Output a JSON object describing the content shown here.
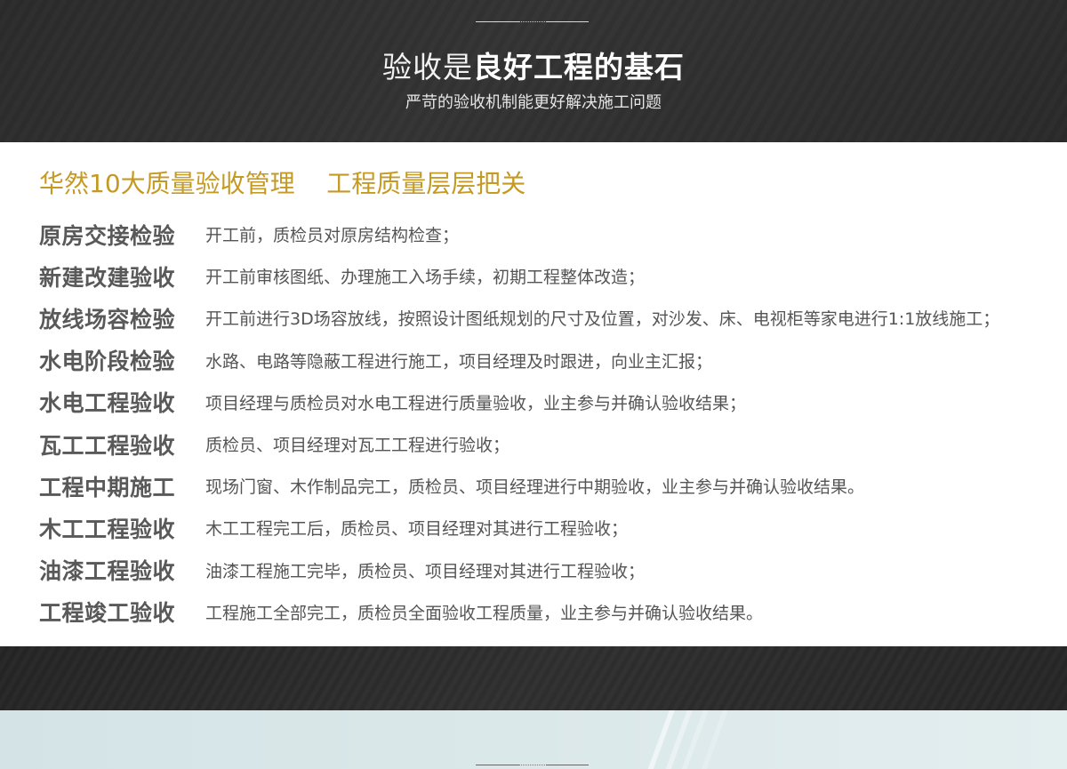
{
  "hero": {
    "title_light": "验收是",
    "title_bold": "良好工程的基石",
    "subtitle": "严苛的验收机制能更好解决施工问题"
  },
  "panel": {
    "heading": "华然10大质量验收管理    工程质量层层把关",
    "rows": [
      {
        "label": "原房交接检验",
        "desc": "开工前，质检员对原房结构检查；"
      },
      {
        "label": "新建改建验收",
        "desc": "开工前审核图纸、办理施工入场手续，初期工程整体改造；"
      },
      {
        "label": "放线场容检验",
        "desc": "开工前进行3D场容放线，按照设计图纸规划的尺寸及位置，对沙发、床、电视柜等家电进行1:1放线施工；"
      },
      {
        "label": "水电阶段检验",
        "desc": "水路、电路等隐蔽工程进行施工，项目经理及时跟进，向业主汇报；"
      },
      {
        "label": "水电工程验收",
        "desc": "项目经理与质检员对水电工程进行质量验收，业主参与并确认验收结果；"
      },
      {
        "label": "瓦工工程验收",
        "desc": "质检员、项目经理对瓦工工程进行验收；"
      },
      {
        "label": "工程中期施工",
        "desc": "现场门窗、木作制品完工，质检员、项目经理进行中期验收，业主参与并确认验收结果。"
      },
      {
        "label": "木工工程验收",
        "desc": "木工工程完工后，质检员、项目经理对其进行工程验收；"
      },
      {
        "label": "油漆工程验收",
        "desc": "油漆工程施工完毕，质检员、项目经理对其进行工程验收；"
      },
      {
        "label": "工程竣工验收",
        "desc": "工程施工全部完工，质检员全面验收工程质量，业主参与并确认验收结果。"
      }
    ]
  },
  "colors": {
    "accent_gold": "#c59a24",
    "hero_bg": "#2b2b2b",
    "label_gray": "#595959",
    "bottom_bg": "#d4e4e6"
  }
}
